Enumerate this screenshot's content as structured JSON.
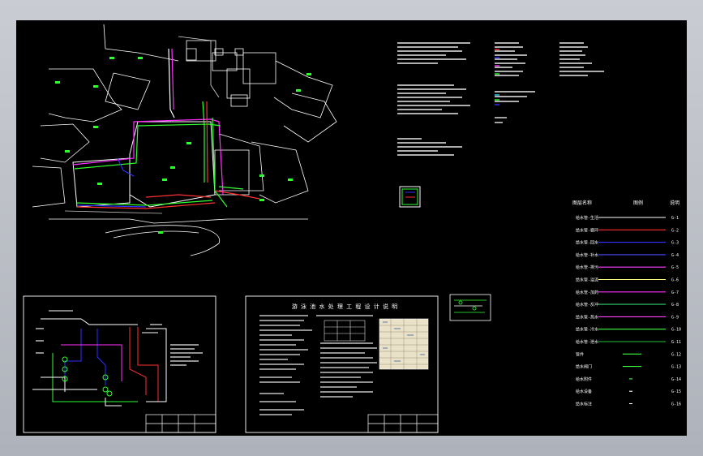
{
  "viewer": {
    "background": "#b8bcc4",
    "canvas_color": "#000000"
  },
  "drawing": {
    "notes_sheet_title": "游 泳 池 水 处 理 工 程 设 计 说 明",
    "legend": {
      "header_name": "图层名称",
      "header_line": "图例",
      "header_remark": "说明",
      "rows": [
        {
          "name": "给水管-生活",
          "color": "#ffffff",
          "remark": "G-1"
        },
        {
          "name": "给水管-循环",
          "color": "#ff3030",
          "remark": "G-2"
        },
        {
          "name": "给水管-回水",
          "color": "#3030ff",
          "remark": "G-3"
        },
        {
          "name": "给水管-补水",
          "color": "#4848ff",
          "remark": "G-4"
        },
        {
          "name": "给水管-排污",
          "color": "#ff40ff",
          "remark": "G-5"
        },
        {
          "name": "给水管-溢流",
          "color": "#ffff80",
          "remark": "G-6"
        },
        {
          "name": "给水管-加药",
          "color": "#ff30ff",
          "remark": "G-7"
        },
        {
          "name": "给水管-反冲",
          "color": "#30d070",
          "remark": "G-8"
        },
        {
          "name": "给水管-热水",
          "color": "#ff40ff",
          "remark": "G-9"
        },
        {
          "name": "给水管-冷水",
          "color": "#40ff40",
          "remark": "G-10"
        },
        {
          "name": "给水管-泄水",
          "color": "#20c040",
          "remark": "G-11"
        },
        {
          "name": "管件",
          "color": "#40ff40",
          "remark": "G-12"
        },
        {
          "name": "给水阀门",
          "color": "#40ff40",
          "remark": "G-13"
        },
        {
          "name": "给水附件",
          "color": "#40ff40",
          "remark": "G-14"
        },
        {
          "name": "给水设备",
          "color": "#ffffff",
          "remark": "G-15"
        },
        {
          "name": "给水标注",
          "color": "#ffffff",
          "remark": "G-16"
        }
      ]
    }
  }
}
